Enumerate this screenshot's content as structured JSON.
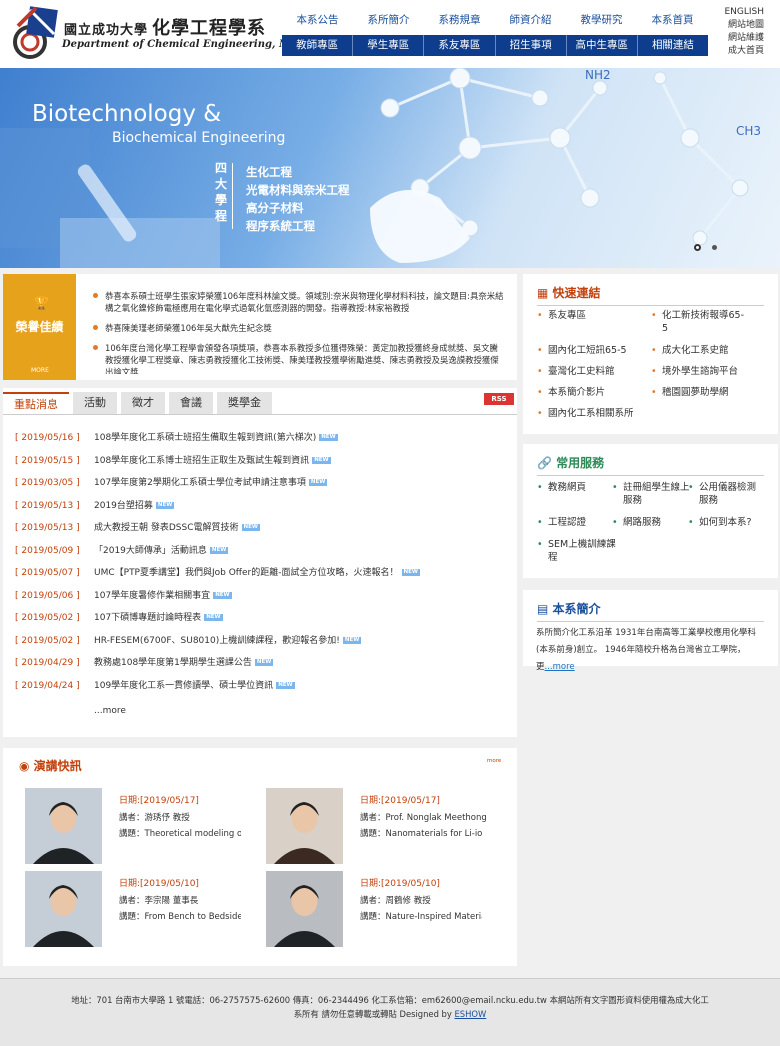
{
  "header": {
    "logo_zh_small": "國立成功大學",
    "logo_zh_big": "化學工程學系",
    "logo_en": "Department of Chemical Engineering, NCKU",
    "top_nav": [
      "本系公告",
      "系所簡介",
      "系務規章",
      "師資介紹",
      "教學研究",
      "本系首頁"
    ],
    "sub_nav": [
      "教師專區",
      "學生專區",
      "系友專區",
      "招生事項",
      "高中生專區",
      "相關連結"
    ],
    "utility": [
      "ENGLISH",
      "網站地圖",
      "網站維護",
      "成大首頁"
    ]
  },
  "banner": {
    "title1": "Biotechnology &",
    "title2": "Biochemical Engineering",
    "vertical": "四大學程",
    "areas": [
      "生化工程",
      "光電材料與奈米工程",
      "高分子材料",
      "程序系統工程"
    ],
    "formula1": "NH2",
    "formula2": "CH3"
  },
  "honor": {
    "title": "榮譽佳績",
    "more": "MORE",
    "items": [
      "恭喜本系碩士班學生張家婷榮獲106年度科林論文獎。領域別:奈米與物理化學材料科技，論文題目:具奈米結構之氧化鎳修飾電極應用在電化學式過氧化氫感測器的開發。指導教授:林家裕教授",
      "恭喜陳美瑾老師榮獲106年吳大猷先生紀念獎",
      "106年度台灣化學工程學會頒發各項獎項，恭喜本系教授多位獲得殊榮：黃定加教授獲終身成就獎、吳文騰教授獲化學工程獎章、陳志勇教授獲化工技術獎、陳美瑾教授獲學術勵進獎、陳志勇教授及吳逸謨教授獲傑出論文獎"
    ]
  },
  "news": {
    "tabs": [
      "重點消息",
      "活動",
      "徵才",
      "會議",
      "獎學金"
    ],
    "rss": "RSS",
    "new_badge": "NEW",
    "items": [
      {
        "date": "[ 2019/05/16 ]",
        "title": "108學年度化工系碩士班招生備取生報到資訊(第六梯次)"
      },
      {
        "date": "[ 2019/05/15 ]",
        "title": "108學年度化工系博士班招生正取生及甄試生報到資訊"
      },
      {
        "date": "[ 2019/03/05 ]",
        "title": "107學年度第2學期化工系碩士學位考試申請注意事項"
      },
      {
        "date": "[ 2019/05/13 ]",
        "title": "2019台塑招募"
      },
      {
        "date": "[ 2019/05/13 ]",
        "title": "成大教授王朝 發表DSSC電解質技術"
      },
      {
        "date": "[ 2019/05/09 ]",
        "title": "「2019大師傳承」活動訊息"
      },
      {
        "date": "[ 2019/05/07 ]",
        "title": "UMC【PTP夏季講堂】我們與Job Offer的距離-面試全方位攻略，火速報名！"
      },
      {
        "date": "[ 2019/05/06 ]",
        "title": "107學年度暑修作業相關事宜"
      },
      {
        "date": "[ 2019/05/02 ]",
        "title": "107下碩博專題討論時程表"
      },
      {
        "date": "[ 2019/05/02 ]",
        "title": "HR-FESEM(6700F、SU8010)上機訓練課程，歡迎報名參加!"
      },
      {
        "date": "[ 2019/04/29 ]",
        "title": "教務處108學年度第1學期學生選課公告"
      },
      {
        "date": "[ 2019/04/24 ]",
        "title": "109學年度化工系一貫修讀學、碩士學位資訊"
      }
    ],
    "more": "...more"
  },
  "quick_links": {
    "title": "快速連結",
    "items": [
      "系友專區",
      "化工新技術報導65-5",
      "國內化工短訊65-5",
      "成大化工系史館",
      "臺灣化工史料館",
      "境外學生諮詢平台",
      "本系簡介影片",
      "稽園圓夢助學網",
      "國內化工系相關系所"
    ]
  },
  "services": {
    "title": "常用服務",
    "items": [
      "教務網頁",
      "註冊組學生線上服務",
      "公用儀器檢測服務",
      "工程認證",
      "網路服務",
      "如何到本系?",
      "SEM上機訓練課程"
    ]
  },
  "intro": {
    "title": "本系簡介",
    "text": "系所簡介化工系沿革 1931年台南高等工業學校應用化學科(本系前身)創立。 1946年隨校升格為台灣省立工學院，更",
    "more": "...more"
  },
  "lectures": {
    "title": "演講快訊",
    "more": "more",
    "items": [
      {
        "date": "日期:[2019/05/17]",
        "speaker": "講者：游琇伃 教授",
        "topic": "講題：Theoretical modeling of"
      },
      {
        "date": "日期:[2019/05/17]",
        "speaker": "講者：Prof. Nonglak Meethong",
        "topic": "講題：Nanomaterials for Li-ion"
      },
      {
        "date": "日期:[2019/05/10]",
        "speaker": "講者：李宗陽 董事長",
        "topic": "講題：From Bench to Bedside,"
      },
      {
        "date": "日期:[2019/05/10]",
        "speaker": "講者：周鶴修 教授",
        "topic": "講題：Nature-Inspired Materials"
      }
    ]
  },
  "footer": {
    "line1": "地址：701 台南市大學路 1 號電話：06-2757575-62600 傳真：06-2344496 化工系信箱：em62600@email.ncku.edu.tw 本網站所有文字圖形資料使用權為成大化工",
    "line2": "系所有 請勿任意轉載或轉貼 Designed by",
    "designer": "ESHOW"
  },
  "colors": {
    "nav_blue": "#0d3d8c",
    "accent_orange": "#c2410c",
    "honor_gold": "#e7a21b",
    "service_green": "#2e8b57"
  }
}
